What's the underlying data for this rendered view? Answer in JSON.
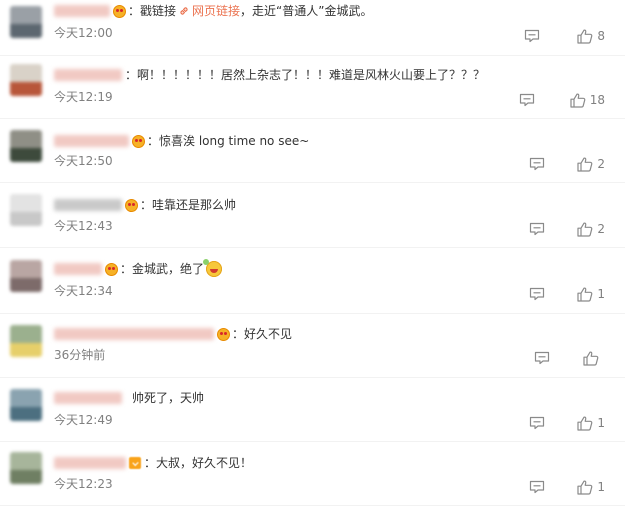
{
  "colors": {
    "text": "#333333",
    "muted": "#808080",
    "link": "#eb7350",
    "icon": "#8a8a8a",
    "divider": "#f2f2f2"
  },
  "comments": [
    {
      "prefix": "：戳链接 ",
      "link_icon": "link-icon",
      "link_text": "网页链接",
      "suffix": " ，走近“普通人”金城武。",
      "time": "今天12:00",
      "likes": "8"
    },
    {
      "text": "：啊！！！！！！居然上杂志了！！！难道是风林火山要上了？？？",
      "time": "今天12:19",
      "likes": "18"
    },
    {
      "text": "：惊喜涘 long time no see~",
      "time": "今天12:50",
      "likes": "2"
    },
    {
      "text": "：哇靠还是那么帅",
      "time": "今天12:43",
      "likes": "2"
    },
    {
      "text": "：金城武，绝了",
      "emoji": "party-face-emoji",
      "time": "今天12:34",
      "likes": "1"
    },
    {
      "text": "：好久不见",
      "time": "36分钟前",
      "likes": ""
    },
    {
      "text": "帅死了，天帅",
      "time": "今天12:49",
      "likes": "1"
    },
    {
      "text": "：大叔，好久不见！",
      "time": "今天12:23",
      "likes": "1"
    }
  ]
}
